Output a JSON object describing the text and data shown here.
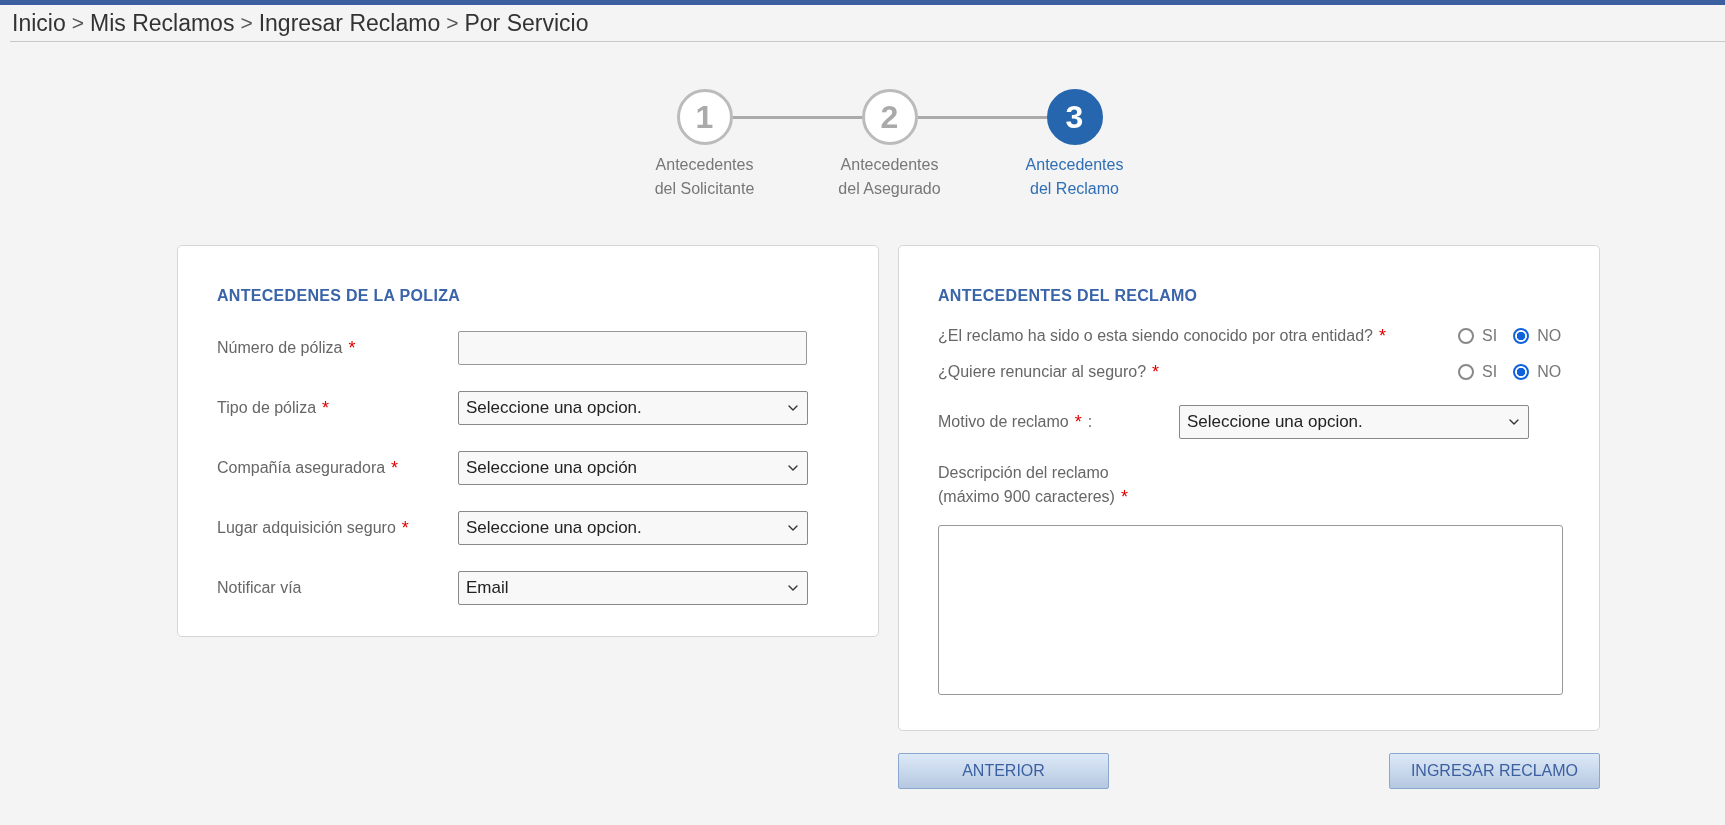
{
  "breadcrumb": {
    "separator": ">",
    "items": [
      {
        "label": "Inicio"
      },
      {
        "label": "Mis Reclamos"
      },
      {
        "label": "Ingresar Reclamo"
      },
      {
        "label": "Por Servicio"
      }
    ]
  },
  "stepper": [
    {
      "number": "1",
      "lines": [
        "Antecedentes",
        "del Solicitante"
      ],
      "selected": false
    },
    {
      "number": "2",
      "lines": [
        "Antecedentes",
        "del Asegurado"
      ],
      "selected": false
    },
    {
      "number": "3",
      "lines": [
        "Antecedentes",
        "del Reclamo"
      ],
      "selected": true
    }
  ],
  "policy_panel": {
    "title": "ANTECEDENES DE LA POLIZA",
    "fields": [
      {
        "kind": "text",
        "label": "Número de póliza",
        "required_mark": "*"
      },
      {
        "kind": "select",
        "label": "Tipo de póliza",
        "required_mark": "*",
        "value": "Seleccione una opcion."
      },
      {
        "kind": "select",
        "label": "Compañía aseguradora",
        "required_mark": "*",
        "value": "Seleccione una opción"
      },
      {
        "kind": "select",
        "label": "Lugar adquisición seguro",
        "required_mark": "*",
        "value": "Seleccione una opcion."
      },
      {
        "kind": "select",
        "label": "Notificar vía",
        "value": "Email"
      }
    ]
  },
  "claim_panel": {
    "title": "ANTECEDENTES DEL RECLAMO",
    "fields": [
      {
        "kind": "radio",
        "label": "¿El reclamo ha sido o esta siendo conocido por otra entidad?",
        "required_mark": "*",
        "options": [
          {
            "label": "SI",
            "selected": false
          },
          {
            "label": "NO",
            "selected": true
          }
        ]
      },
      {
        "kind": "radio",
        "label": "¿Quiere renunciar al seguro?",
        "required_mark": "*",
        "options": [
          {
            "label": "SI",
            "selected": false
          },
          {
            "label": "NO",
            "selected": true
          }
        ]
      },
      {
        "kind": "select",
        "label": "Motivo de reclamo",
        "required_mark": "*",
        "suffix": ":",
        "value": "Seleccione una opcion."
      },
      {
        "kind": "textarea",
        "label_lines": [
          "Descripción del reclamo",
          "(máximo 900 caracteres)"
        ],
        "required_mark": "*"
      }
    ]
  },
  "buttons": [
    {
      "label": "ANTERIOR"
    },
    {
      "label": "INGRESAR RECLAMO"
    }
  ]
}
